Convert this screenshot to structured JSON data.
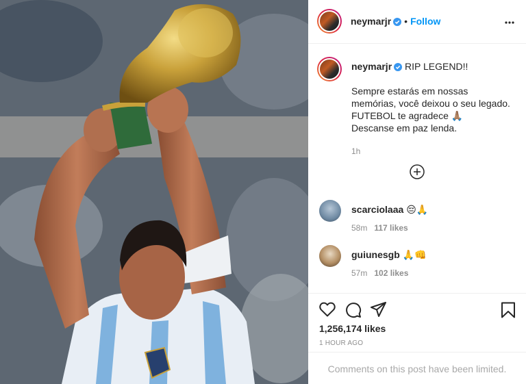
{
  "header": {
    "username": "neymarjr",
    "separator": "•",
    "follow_label": "Follow",
    "more_icon": "ellipsis-icon",
    "verified_icon": "verified-badge-icon"
  },
  "caption": {
    "username": "neymarjr",
    "first_line": "RIP LEGEND!!",
    "lines": [
      "Sempre estarás em nossas",
      "memórias, você deixou o seu legado.",
      "FUTEBOL te agradece 🙏🏽",
      "Descanse em paz lenda."
    ],
    "time": "1h"
  },
  "load_more_icon": "plus-circle-icon",
  "comments": [
    {
      "username": "scarciolaaa",
      "text": "😔🙏",
      "time": "58m",
      "likes": "117 likes"
    },
    {
      "username": "guiunesgb",
      "text": "🙏👊",
      "time": "57m",
      "likes": "102 likes"
    }
  ],
  "actions": {
    "like_icon": "heart-icon",
    "comment_icon": "comment-icon",
    "share_icon": "send-icon",
    "save_icon": "bookmark-icon",
    "likes": "1,256,174 likes",
    "posted": "1 HOUR AGO",
    "limited_notice": "Comments on this post have been limited."
  },
  "colors": {
    "link_blue": "#0095f6",
    "verified_blue": "#3897f0",
    "text": "#262626",
    "muted": "#8e8e8e",
    "border": "#efefef"
  }
}
